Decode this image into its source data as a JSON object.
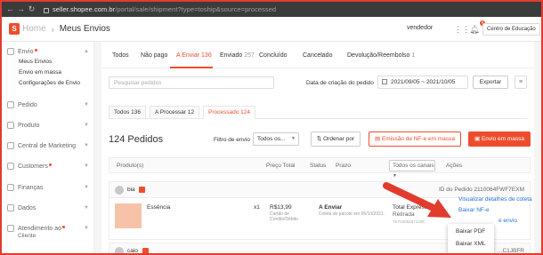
{
  "browser": {
    "url_host": "seller.shopee.com.br",
    "url_path": "/portal/sale/shipment?type=toship&source=processed"
  },
  "header": {
    "brand": "Home",
    "separator": "›",
    "page_title": "Meus Envios",
    "user": "vendedor",
    "notification_count": "F",
    "edu_button": "Centro de Educação"
  },
  "sidebar": {
    "envio": {
      "label": "Envio"
    },
    "envio_items": [
      "Meus Envios",
      "Envio em massa",
      "Configurações de Envio"
    ],
    "groups": [
      {
        "label": "Pedido"
      },
      {
        "label": "Produto"
      },
      {
        "label": "Central de Marketing"
      },
      {
        "label": "Customers"
      },
      {
        "label": "Finanças"
      },
      {
        "label": "Dados"
      },
      {
        "label": "Atendimento ao"
      }
    ],
    "groups_cont": "Cliente"
  },
  "status_tabs": [
    {
      "label": "Todos",
      "count": ""
    },
    {
      "label": "Não pago",
      "count": ""
    },
    {
      "label": "A Enviar",
      "count": "136"
    },
    {
      "label": "Enviado",
      "count": "257"
    },
    {
      "label": "Concluído",
      "count": ""
    },
    {
      "label": "Cancelado",
      "count": ""
    },
    {
      "label": "Devolução/Reembolso",
      "count": "1"
    }
  ],
  "filters": {
    "search_placeholder": "Pesquisar pedidos",
    "date_label": "Data de criação do pedido",
    "date_range": "2021/09/05 ~ 2021/10/05",
    "export_label": "Exportar"
  },
  "sub_tabs": [
    {
      "label": "Todos",
      "count": "136"
    },
    {
      "label": "A Processar",
      "count": "12"
    },
    {
      "label": "Processado",
      "count": "124"
    }
  ],
  "toolbar": {
    "count_title": "124 Pedidos",
    "filter_label": "Filtro de envio",
    "filter_value": "Todos os...",
    "sort_label": "Ordenar por",
    "nfe_label": "Emissão de NF-e em massa",
    "mass_label": "Envio em massa"
  },
  "table": {
    "headers": [
      "Produto(s)",
      "Preço Total",
      "Status",
      "Prazo",
      "Todos os canais",
      "Ações"
    ]
  },
  "orders": [
    {
      "buyer": "bia",
      "order_id": "ID do Pedido 2110064FWF7EXM",
      "product": "Essência",
      "qty": "x1",
      "price": "R$13,99",
      "payment": "Cartão de Crédito/Débito",
      "status": "A Enviar",
      "status_sub": "Coleta do pacote em 06/10/2021.",
      "shipping": "Total Express",
      "shipping_sub": "Retirada",
      "tracking": "TE724052671248",
      "actions": [
        "Visualizar detalhes de coleta",
        "Baixar NF-e",
        "e envio"
      ]
    },
    {
      "buyer": "caio",
      "order_id": "…C1JBFR"
    }
  ],
  "dropdown": {
    "items": [
      "Baixar PDF",
      "Baixar XML"
    ]
  },
  "colors": {
    "accent": "#ee4d2d",
    "link": "#2673dd",
    "annotation": "#e23b2e"
  }
}
